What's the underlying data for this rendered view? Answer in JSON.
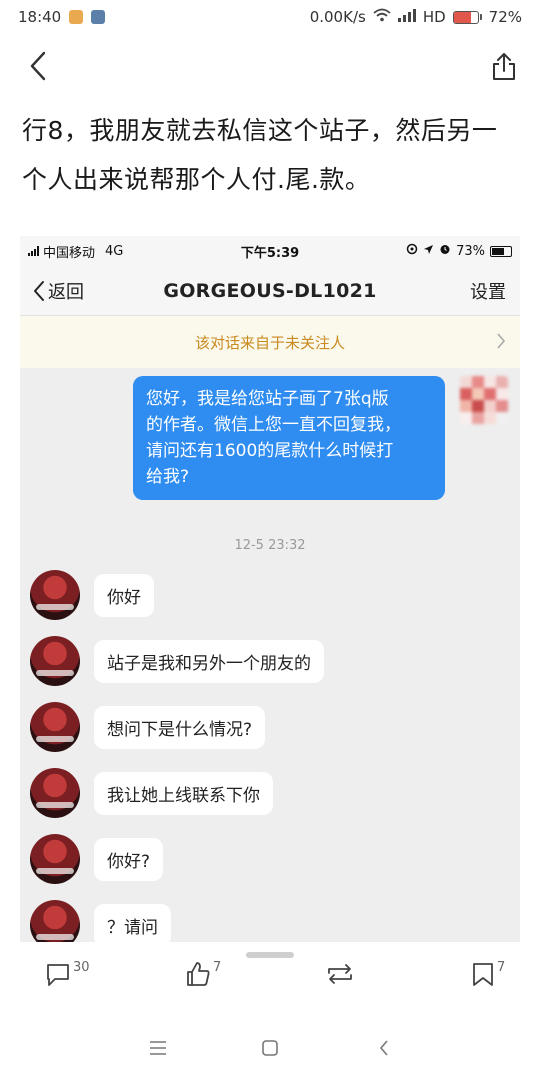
{
  "status_bar": {
    "time": "18:40",
    "network_speed": "0.00K/s",
    "hd_label": "HD",
    "battery_text": "72%",
    "battery_level_percent": 72,
    "icons": [
      "notification-app-icon",
      "gallery-app-icon",
      "wifi-icon",
      "signal-icon",
      "battery-icon"
    ]
  },
  "top_nav": {
    "icons": [
      "back-arrow-icon",
      "share-icon"
    ]
  },
  "post": {
    "lines": [
      "行8，我朋友就去私信这个站子，然后另一",
      "个人出来说帮那个人付.尾.款。"
    ]
  },
  "screenshot": {
    "status": {
      "carrier": "中国移动",
      "network": "4G",
      "time": "下午5:39",
      "battery_text": "73%",
      "battery_level_percent": 73
    },
    "nav": {
      "back_label": "返回",
      "title": "GORGEOUS-DL1021",
      "settings_label": "设置"
    },
    "notice": "该对话来自于未关注人",
    "outgoing": {
      "lines": [
        "您好，我是给您站子画了7张q版",
        "的作者。微信上您一直不回复我，",
        "请问还有1600的尾款什么时候打",
        "给我?"
      ]
    },
    "timestamp": "12-5 23:32",
    "incoming": [
      {
        "text": "你好"
      },
      {
        "text": "站子是我和另外一个朋友的"
      },
      {
        "text": "想问下是什么情况?"
      },
      {
        "text": "我让她上线联系下你"
      },
      {
        "text": "你好?"
      },
      {
        "text": "？请问"
      }
    ]
  },
  "actions": {
    "comment_count": "30",
    "like_count": "7",
    "favorite_count": "7"
  },
  "colors": {
    "accent_blue": "#2f8cf0",
    "notice_text": "#c98a1f",
    "notice_bg": "#fbf8ec",
    "chat_bg": "#eeeeee"
  }
}
